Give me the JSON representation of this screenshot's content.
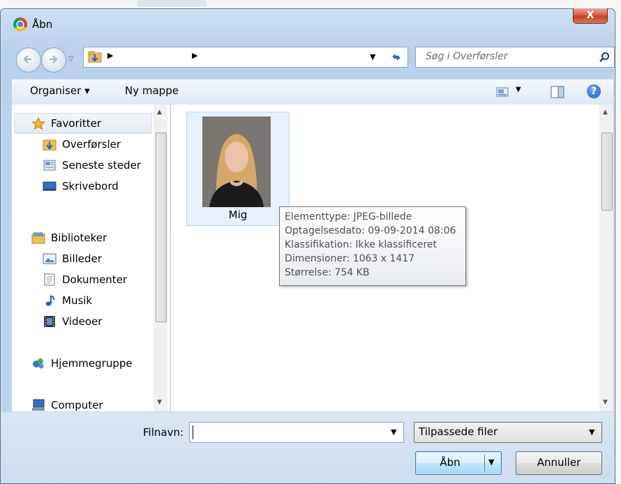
{
  "dialog": {
    "title": "Åbn",
    "close_label": "X"
  },
  "address": {
    "path": "",
    "search_placeholder": "Søg i Overførsler"
  },
  "toolbar": {
    "organise_label": "Organiser ▾",
    "new_folder_label": "Ny mappe"
  },
  "sidebar": {
    "items": [
      {
        "label": "Favoritter",
        "icon": "star-icon"
      },
      {
        "label": "Overførsler",
        "icon": "downloads-folder-icon"
      },
      {
        "label": "Seneste steder",
        "icon": "recent-places-icon"
      },
      {
        "label": "Skrivebord",
        "icon": "desktop-icon"
      },
      {
        "label": "Biblioteker",
        "icon": "libraries-icon"
      },
      {
        "label": "Billeder",
        "icon": "pictures-icon"
      },
      {
        "label": "Dokumenter",
        "icon": "documents-icon"
      },
      {
        "label": "Musik",
        "icon": "music-icon"
      },
      {
        "label": "Videoer",
        "icon": "videos-icon"
      },
      {
        "label": "Hjemmegruppe",
        "icon": "homegroup-icon"
      },
      {
        "label": "Computer",
        "icon": "computer-icon"
      }
    ]
  },
  "files": [
    {
      "name": "Mig",
      "type": "jpeg-thumbnail"
    }
  ],
  "tooltip": {
    "lines": [
      "Elementtype: JPEG-billede",
      "Optagelsesdato: 09-09-2014 08:06",
      "Klassifikation: Ikke klassificeret",
      "Dimensioner: 1063 x 1417",
      "Størrelse: 754 KB"
    ]
  },
  "bottom": {
    "filename_label": "Filnavn:",
    "filename_value": "",
    "filter_value": "Tilpassede filer",
    "open_label": "Åbn",
    "cancel_label": "Annuller"
  },
  "colors": {
    "frame": "#b9d1ec",
    "selection": "#e7f1fb",
    "close_button": "#c43c1f"
  }
}
